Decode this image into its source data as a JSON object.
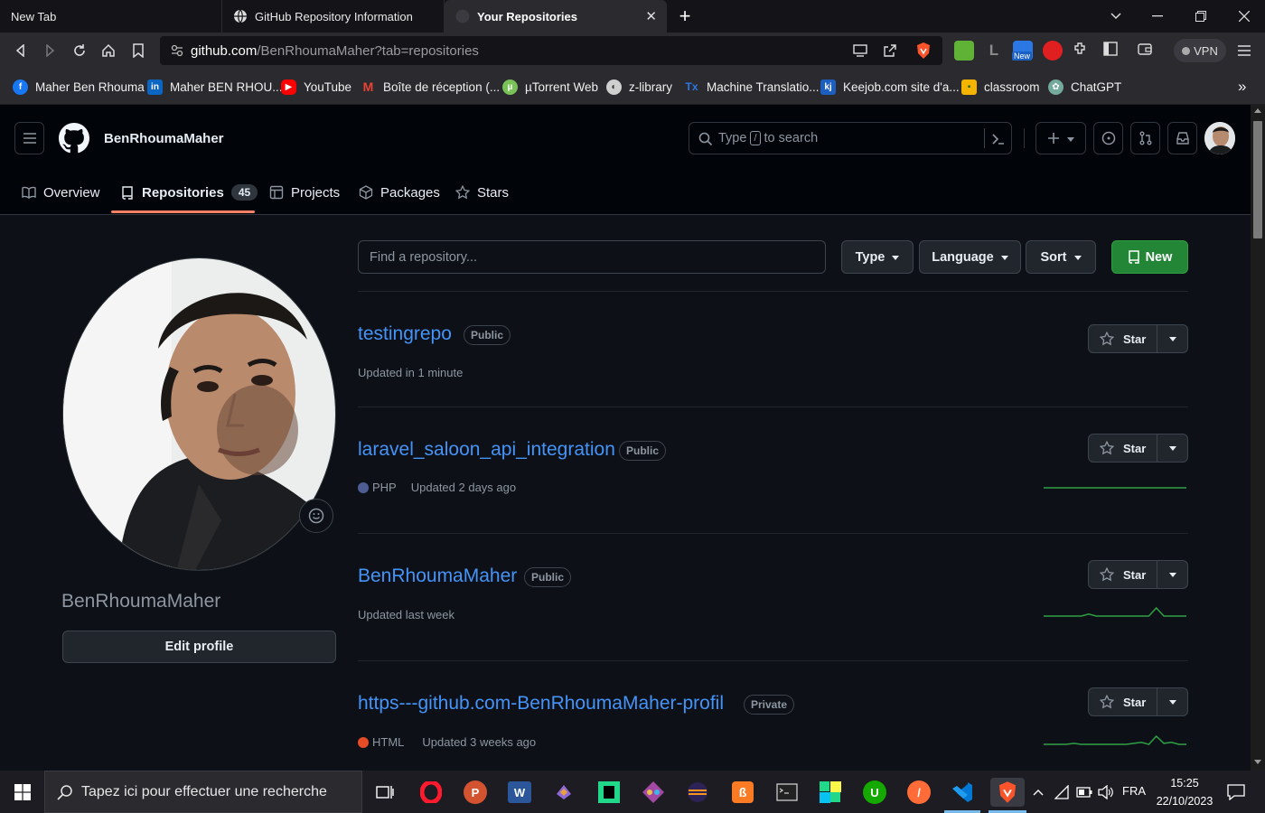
{
  "browser": {
    "tabs": [
      {
        "title": "New Tab",
        "active": false
      },
      {
        "title": "GitHub Repository Information",
        "active": false
      },
      {
        "title": "Your Repositories",
        "active": true
      }
    ],
    "url_host": "github.com",
    "url_path": "/BenRhoumaMaher?tab=repositories",
    "vpn_label": "VPN",
    "ext_new_badge": "New",
    "bookmarks": [
      {
        "label": "Maher Ben Rhouma",
        "icon": "facebook-icon",
        "color": "#1877f2"
      },
      {
        "label": "Maher BEN RHOU...",
        "icon": "linkedin-icon",
        "color": "#0a66c2"
      },
      {
        "label": "YouTube",
        "icon": "youtube-icon",
        "color": "#ff0000"
      },
      {
        "label": "Boîte de réception (...",
        "icon": "gmail-icon",
        "color": "#ea4335"
      },
      {
        "label": "µTorrent Web",
        "icon": "utorrent-icon",
        "color": "#78c257"
      },
      {
        "label": "z-library",
        "icon": "zlibrary-icon",
        "color": "#cfcfcf"
      },
      {
        "label": "Machine Translatio...",
        "icon": "translation-icon",
        "color": "#2b78e4"
      },
      {
        "label": "Keejob.com site d'a...",
        "icon": "keejob-icon",
        "color": "#1d5fbf"
      },
      {
        "label": "classroom",
        "icon": "classroom-icon",
        "color": "#f4b400"
      },
      {
        "label": "ChatGPT",
        "icon": "chatgpt-icon",
        "color": "#74aa9c"
      }
    ],
    "bookmarks_more": "»"
  },
  "github": {
    "header_username": "BenRhoumaMaher",
    "search_prefix": "Type",
    "search_key": "/",
    "search_suffix": "to search",
    "profile_tabs": [
      {
        "label": "Overview",
        "icon": "book-icon"
      },
      {
        "label": "Repositories",
        "icon": "repo-icon",
        "count": "45",
        "selected": true
      },
      {
        "label": "Projects",
        "icon": "table-icon"
      },
      {
        "label": "Packages",
        "icon": "package-icon"
      },
      {
        "label": "Stars",
        "icon": "star-icon"
      }
    ]
  },
  "sidebar": {
    "username": "BenRhoumaMaher",
    "edit_profile": "Edit profile"
  },
  "filters": {
    "search_placeholder": "Find a repository...",
    "type": "Type",
    "language": "Language",
    "sort": "Sort",
    "new": "New"
  },
  "repos": [
    {
      "name": "testingrepo",
      "visibility": "Public",
      "language": "",
      "language_color": "",
      "updated": "Updated in 1 minute",
      "star_label": "Star",
      "activity": []
    },
    {
      "name": "laravel_saloon_api_integration",
      "visibility": "Public",
      "language": "PHP",
      "language_color": "#4F5D95",
      "updated": "Updated 2 days ago",
      "star_label": "Star",
      "activity": [
        0,
        0,
        0,
        0,
        0,
        0,
        0,
        0,
        0,
        0,
        0,
        0,
        0,
        0,
        0,
        0,
        0,
        0,
        0,
        0
      ]
    },
    {
      "name": "BenRhoumaMaher",
      "visibility": "Public",
      "language": "",
      "language_color": "",
      "updated": "Updated last week",
      "star_label": "Star",
      "activity": [
        0,
        0,
        0,
        0,
        0,
        0,
        1,
        0,
        0,
        0,
        0,
        0,
        0,
        0,
        0,
        4,
        0,
        0,
        0,
        0
      ]
    },
    {
      "name": "https---github.com-BenRhoumaMaher-profil",
      "visibility": "Private",
      "language": "HTML",
      "language_color": "#e34c26",
      "updated": "Updated 3 weeks ago",
      "star_label": "Star",
      "activity": [
        0,
        0,
        0,
        0,
        1,
        0,
        0,
        0,
        0,
        0,
        0,
        0,
        1,
        2,
        0,
        8,
        1,
        2,
        0,
        0
      ]
    }
  ],
  "taskbar": {
    "search_placeholder": "Tapez ici pour effectuer une recherche",
    "language": "FRA",
    "time": "15:25",
    "date": "22/10/2023"
  }
}
